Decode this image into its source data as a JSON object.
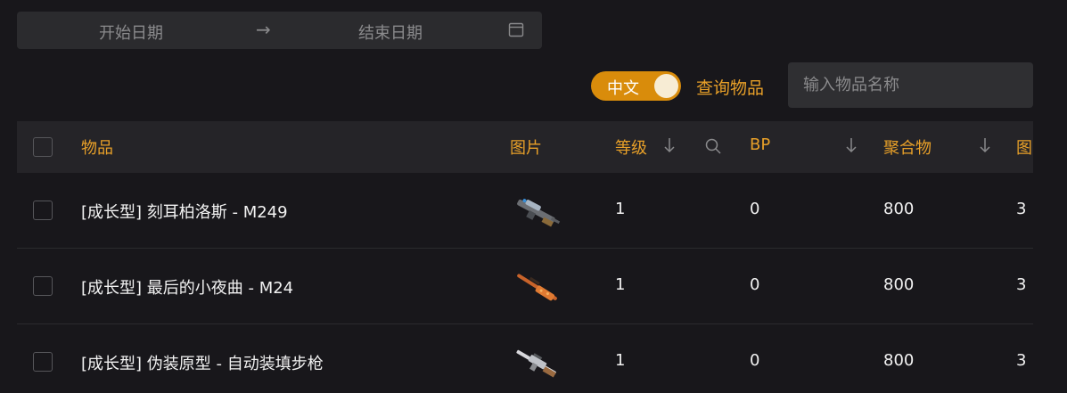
{
  "date_range": {
    "start_placeholder": "开始日期",
    "arrow": "→",
    "end_placeholder": "结束日期",
    "icon": "calendar-icon"
  },
  "toolbar": {
    "language_toggle_label": "中文",
    "language_toggle_on": true,
    "query_label": "查询物品",
    "search_placeholder": "输入物品名称"
  },
  "table": {
    "columns": {
      "item": "物品",
      "image": "图片",
      "level": "等级",
      "bp": "BP",
      "aggregate": "聚合物",
      "extra": "图"
    },
    "rows": [
      {
        "name": "[成长型] 刻耳柏洛斯 - M249",
        "level": "1",
        "bp": "0",
        "aggregate": "800",
        "extra": "3",
        "image": "m249-weapon-image"
      },
      {
        "name": "[成长型] 最后的小夜曲 - M24",
        "level": "1",
        "bp": "0",
        "aggregate": "800",
        "extra": "3",
        "image": "m24-weapon-image"
      },
      {
        "name": "[成长型] 伪装原型 - 自动装填步枪",
        "level": "1",
        "bp": "0",
        "aggregate": "800",
        "extra": "3",
        "image": "rifle-weapon-image"
      }
    ]
  },
  "colors": {
    "accent": "#e8a028",
    "toggle": "#d98c0b",
    "background": "#18171b"
  }
}
